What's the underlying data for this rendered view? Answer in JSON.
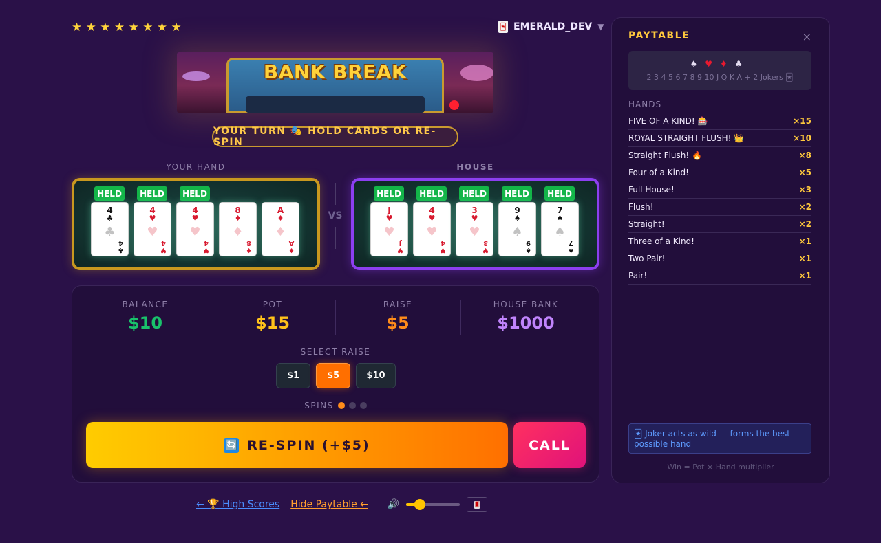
{
  "header": {
    "stars": "★ ★ ★ ★ ★ ★ ★ ★",
    "username": "EMERALD_DEV",
    "user_icon": "🃏",
    "caret": "▼"
  },
  "banner": {
    "title": "BANK BREAK"
  },
  "turn_message": "YOUR TURN 🎭 HOLD CARDS OR RE-SPIN",
  "your_hand": {
    "label": "YOUR HAND",
    "held_label": "HELD",
    "cards": [
      {
        "rank": "4",
        "suit": "♣",
        "color": "black",
        "held": true
      },
      {
        "rank": "4",
        "suit": "♥",
        "color": "red",
        "held": true
      },
      {
        "rank": "4",
        "suit": "♥",
        "color": "red",
        "held": true
      },
      {
        "rank": "8",
        "suit": "♦",
        "color": "red",
        "held": false
      },
      {
        "rank": "A",
        "suit": "♦",
        "color": "red",
        "held": false
      }
    ]
  },
  "vs_label": "VS",
  "house_hand": {
    "label": "HOUSE",
    "held_label": "HELD",
    "cards": [
      {
        "rank": "J",
        "suit": "♥",
        "color": "red",
        "held": true
      },
      {
        "rank": "4",
        "suit": "♥",
        "color": "red",
        "held": true
      },
      {
        "rank": "3",
        "suit": "♥",
        "color": "red",
        "held": true
      },
      {
        "rank": "9",
        "suit": "♠",
        "color": "black",
        "held": true
      },
      {
        "rank": "7",
        "suit": "♠",
        "color": "black",
        "held": true
      }
    ]
  },
  "stats": {
    "balance": {
      "label": "BALANCE",
      "value": "$10",
      "color": "#19c26b"
    },
    "pot": {
      "label": "POT",
      "value": "$15",
      "color": "#ffc21a"
    },
    "raise": {
      "label": "RAISE",
      "value": "$5",
      "color": "#ff8c1a"
    },
    "house_bank": {
      "label": "HOUSE BANK",
      "value": "$1000",
      "color": "#c084fc"
    }
  },
  "select_raise": {
    "label": "SELECT RAISE",
    "options": [
      "$1",
      "$5",
      "$10"
    ],
    "selected": "$5"
  },
  "spins": {
    "label": "SPINS",
    "total": 3,
    "used": 1
  },
  "buttons": {
    "respin_icon": "🔄",
    "respin_label": "RE-SPIN (+$5)",
    "call_label": "CALL"
  },
  "footer": {
    "high_scores": "← 🏆 High Scores",
    "hide_paytable": "Hide Paytable ←",
    "volume_icon": "🔊",
    "volume_level": 0.25,
    "deck_icon": "🂠"
  },
  "paytable": {
    "title": "PAYTABLE",
    "close": "×",
    "suits": "♠ ♥ ♦ ♣",
    "ranks": "2 3 4 5 6 7 8 9 10 J Q K A + 2 Jokers 🃏",
    "hands_label": "HANDS",
    "hands": [
      {
        "name": "FIVE OF A KIND! 🎰",
        "mult": "×15"
      },
      {
        "name": "ROYAL STRAIGHT FLUSH! 👑",
        "mult": "×10"
      },
      {
        "name": "Straight Flush! 🔥",
        "mult": "×8"
      },
      {
        "name": "Four of a Kind!",
        "mult": "×5"
      },
      {
        "name": "Full House!",
        "mult": "×3"
      },
      {
        "name": "Flush!",
        "mult": "×2"
      },
      {
        "name": "Straight!",
        "mult": "×2"
      },
      {
        "name": "Three of a Kind!",
        "mult": "×1"
      },
      {
        "name": "Two Pair!",
        "mult": "×1"
      },
      {
        "name": "Pair!",
        "mult": "×1"
      }
    ],
    "joker_note": "🃏 Joker acts as wild — forms the best possible hand",
    "footer_note": "Win = Pot × Hand multiplier"
  }
}
